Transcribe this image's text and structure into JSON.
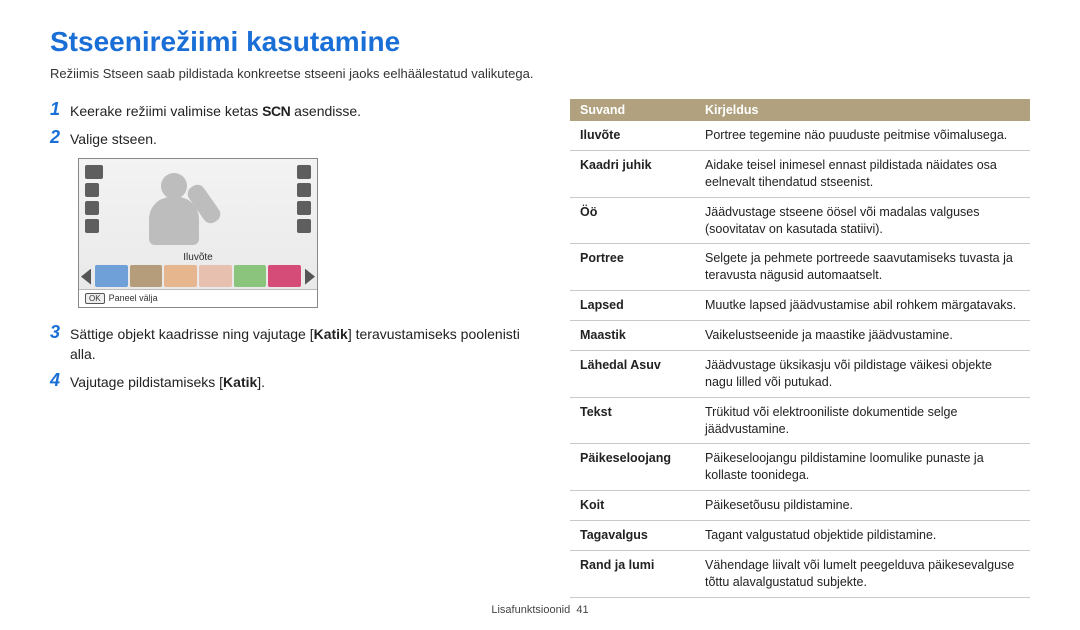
{
  "title": "Stseenirežiimi kasutamine",
  "intro": "Režiimis Stseen saab pildistada konkreetse stseeni jaoks eelhäälestatud valikutega.",
  "steps": {
    "s1_pre": "Keerake režiimi valimise ketas ",
    "s1_scn": "SCN",
    "s1_post": " asendisse.",
    "s2": "Valige stseen.",
    "s3_a": "Sättige objekt kaadrisse ning vajutage [",
    "s3_k": "Katik",
    "s3_b": "] teravustamiseks poolenisti alla.",
    "s4_a": "Vajutage pildistamiseks [",
    "s4_k": "Katik",
    "s4_b": "]."
  },
  "cam": {
    "mode_label": "Iluvõte",
    "panel_btn": "OK",
    "panel_text": "Paneel välja"
  },
  "table": {
    "head_opt": "Suvand",
    "head_desc": "Kirjeldus",
    "rows": [
      {
        "k": "Iluvõte",
        "v": "Portree tegemine näo puuduste peitmise võimalusega."
      },
      {
        "k": "Kaadri juhik",
        "v": "Aidake teisel inimesel ennast pildistada näidates osa eelnevalt tihendatud stseenist."
      },
      {
        "k": "Öö",
        "v": "Jäädvustage stseene öösel või madalas valguses (soovitatav on kasutada statiivi)."
      },
      {
        "k": "Portree",
        "v": "Selgete ja pehmete portreede saavutamiseks tuvasta ja teravusta nägusid automaatselt."
      },
      {
        "k": "Lapsed",
        "v": "Muutke lapsed jäädvustamise abil rohkem märgatavaks."
      },
      {
        "k": "Maastik",
        "v": "Vaikelustseenide ja maastike jäädvustamine."
      },
      {
        "k": "Lähedal Asuv",
        "v": "Jäädvustage üksikasju või pildistage väikesi objekte nagu lilled või putukad."
      },
      {
        "k": "Tekst",
        "v": "Trükitud või elektrooniliste dokumentide selge jäädvustamine."
      },
      {
        "k": "Päikeseloojang",
        "v": "Päikeseloojangu pildistamine loomulike punaste ja kollaste toonidega."
      },
      {
        "k": "Koit",
        "v": "Päikesetõusu pildistamine."
      },
      {
        "k": "Tagavalgus",
        "v": "Tagant valgustatud objektide pildistamine."
      },
      {
        "k": "Rand ja lumi",
        "v": "Vähendage liivalt või lumelt peegelduva päikesevalguse tõttu alavalgustatud subjekte."
      }
    ]
  },
  "footer": {
    "section": "Lisafunktsioonid",
    "page": "41"
  }
}
